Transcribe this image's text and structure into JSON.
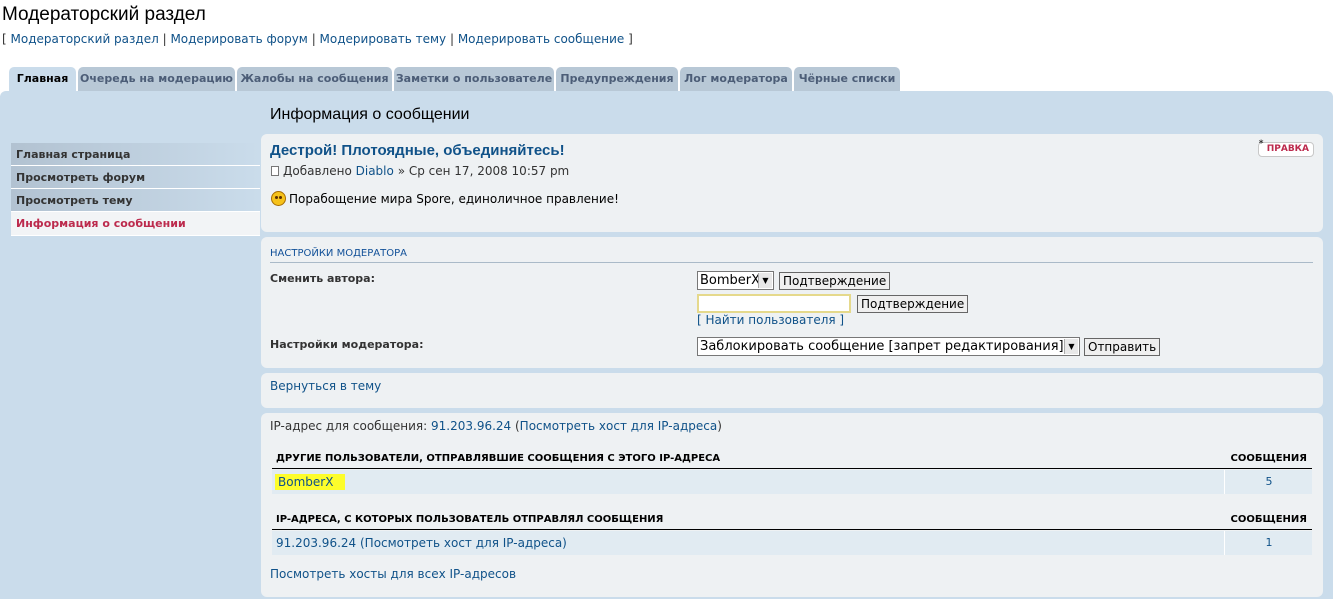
{
  "header": {
    "title": "Модераторский раздел",
    "links": [
      "Модераторский раздел",
      "Модерировать форум",
      "Модерировать тему",
      "Модерировать сообщение"
    ]
  },
  "tabs": [
    {
      "label": "Главная",
      "active": true
    },
    {
      "label": "Очередь на модерацию"
    },
    {
      "label": "Жалобы на сообщения"
    },
    {
      "label": "Заметки о пользователе"
    },
    {
      "label": "Предупреждения"
    },
    {
      "label": "Лог модератора"
    },
    {
      "label": "Чёрные списки"
    }
  ],
  "menu": [
    {
      "label": "Главная страница"
    },
    {
      "label": "Просмотреть форум"
    },
    {
      "label": "Просмотреть тему"
    },
    {
      "label": "Информация о сообщении",
      "active": true
    }
  ],
  "section_title": "Информация о сообщении",
  "post": {
    "title": "Дестрой! Плотоядные, объединяйтесь!",
    "added_prefix": "Добавлено",
    "author": "Diablo",
    "date": "» Ср сен 17, 2008 10:57 pm",
    "body": "Порабощение мира Spore, единоличное правление!",
    "edit_label": "ПРАВКА"
  },
  "moderator": {
    "heading": "НАСТРОЙКИ МОДЕРАТОРА",
    "change_author_label": "Сменить автора:",
    "author_select_value": "BomberX",
    "confirm_label": "Подтверждение",
    "author_input_value": "",
    "find_user_label": "[ Найти пользователя ]",
    "settings_label": "Настройки модератора:",
    "action_select_value": "Заблокировать сообщение [запрет редактирования]",
    "submit_label": "Отправить"
  },
  "back_link": "Вернуться в тему",
  "ip_info": {
    "prefix": "IP-адрес для сообщения:",
    "ip": "91.203.96.24",
    "lookup_label": "Посмотреть хост для IP-адреса",
    "users_header": "ДРУГИЕ ПОЛЬЗОВАТЕЛИ, ОТПРАВЛЯВШИЕ СООБЩЕНИЯ С ЭТОГО IP-АДРЕСА",
    "posts_header": "СООБЩЕНИЯ",
    "users": [
      {
        "name": "BomberX",
        "posts": "5"
      }
    ],
    "ips_header": "IP-АДРЕСА, С КОТОРЫХ ПОЛЬЗОВАТЕЛЬ ОТПРАВЛЯЛ СООБЩЕНИЯ",
    "ips": [
      {
        "ip": "91.203.96.24",
        "lookup": "(Посмотреть хост для IP-адреса)",
        "posts": "1"
      }
    ],
    "all_hosts_label": "Посмотреть хосты для всех IP-адресов"
  },
  "colors": {
    "accent": "#105289",
    "active_menu": "#bc2a4d",
    "panel": "#cadceb",
    "highlight": "#fdfd2b"
  }
}
